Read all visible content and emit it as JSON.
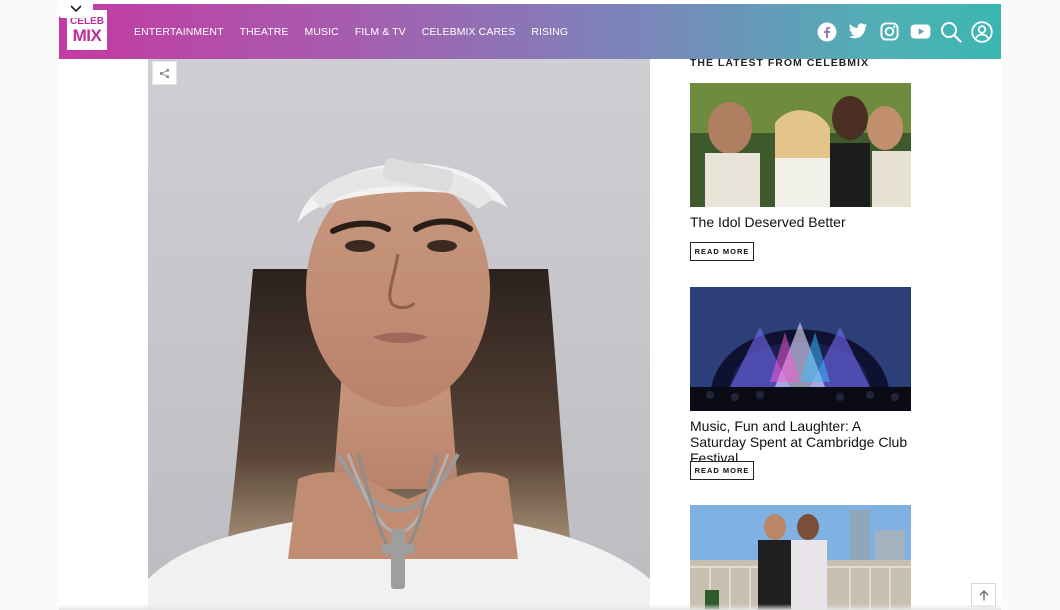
{
  "brand": {
    "logo_line1": "CELEB",
    "logo_line2": "MIX",
    "logo_color": "#c02c96",
    "gradient_start": "#c43aa3",
    "gradient_end": "#3bb6b1"
  },
  "nav": {
    "items": [
      {
        "label": "ENTERTAINMENT"
      },
      {
        "label": "THEATRE"
      },
      {
        "label": "MUSIC"
      },
      {
        "label": "FILM & TV"
      },
      {
        "label": "CELEBMIX CARES"
      },
      {
        "label": "RISING"
      }
    ]
  },
  "header_icons": [
    "facebook-icon",
    "twitter-icon",
    "instagram-icon",
    "youtube-icon",
    "search-icon",
    "user-icon"
  ],
  "sidebar": {
    "heading": "THE LATEST FROM CELEBMIX",
    "posts": [
      {
        "title": "The Idol Deserved Better",
        "read_more": "READ MORE"
      },
      {
        "title": "Music, Fun and Laughter: A Saturday Spent at Cambridge Club Festival",
        "read_more": "READ MORE"
      },
      {
        "title": "",
        "read_more": ""
      }
    ]
  },
  "hero": {
    "description_icon": "share-icon"
  }
}
